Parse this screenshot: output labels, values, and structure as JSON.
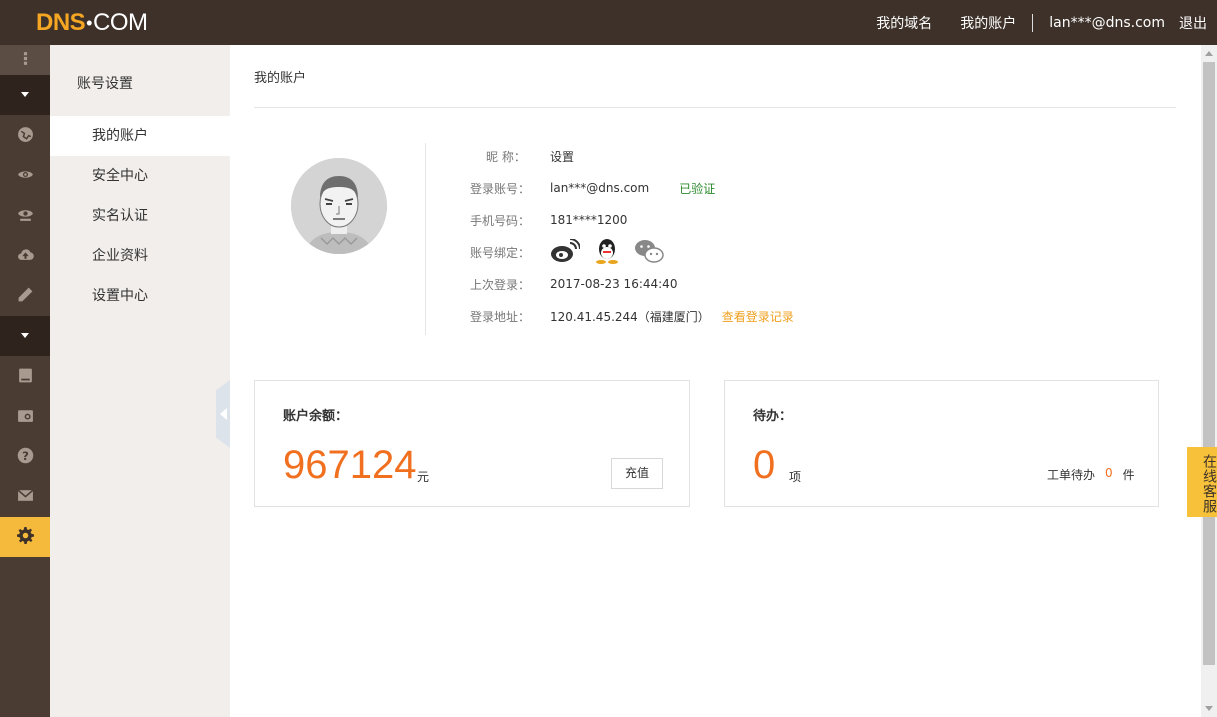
{
  "brand": {
    "logo_a": "DNS",
    "logo_dot": "•",
    "logo_b": "COM"
  },
  "topnav": {
    "my_domains": "我的域名",
    "my_account": "我的账户",
    "user_email": "lan***@dns.com",
    "logout": "退出"
  },
  "rail": {
    "icons": [
      "grip-icon",
      "caret-down-icon",
      "globe-icon",
      "eye-icon",
      "monitor-eye-icon",
      "cloud-upload-icon",
      "pencil-icon",
      "caret-down-icon",
      "book-icon",
      "image-icon",
      "help-icon",
      "mail-icon",
      "gear-icon"
    ],
    "active": "gear-icon",
    "colors": {
      "bg": "#4a3c32",
      "active": "#f5b93b",
      "toggle": "#2f241d"
    }
  },
  "subnav": {
    "title": "账号设置",
    "items": [
      {
        "label": "我的账户",
        "active": true
      },
      {
        "label": "安全中心",
        "active": false
      },
      {
        "label": "实名认证",
        "active": false
      },
      {
        "label": "企业资料",
        "active": false
      },
      {
        "label": "设置中心",
        "active": false
      }
    ]
  },
  "main": {
    "page_title": "我的账户",
    "profile": {
      "nickname_label": "昵  称：",
      "nickname_value": "设置",
      "account_label": "登录账号：",
      "account_value": "lan***@dns.com",
      "verified": "已验证",
      "phone_label": "手机号码：",
      "phone_value": "181****1200",
      "binding_label": "账号绑定：",
      "bindings": [
        "weibo-icon",
        "qq-icon",
        "wechat-icon"
      ],
      "last_login_label": "上次登录：",
      "last_login_value": "2017-08-23 16:44:40",
      "login_ip_label": "登录地址：",
      "login_ip_value": "120.41.45.244（福建厦门）",
      "login_history_link": "查看登录记录"
    },
    "balance_card": {
      "heading": "账户余额：",
      "amount": "967124",
      "unit": "元",
      "recharge_button": "充值"
    },
    "todo_card": {
      "heading": "待办：",
      "count": "0",
      "unit": "项",
      "ticket_label": "工单待办",
      "ticket_count": "0",
      "ticket_unit": "件"
    }
  },
  "service_float": "在线客服",
  "colors": {
    "topbar": "#3d3129",
    "accent_orange": "#f07020",
    "link_orange": "#f0a020",
    "verified_green": "#2e8b2e",
    "subnav_bg": "#f2eeeb"
  }
}
